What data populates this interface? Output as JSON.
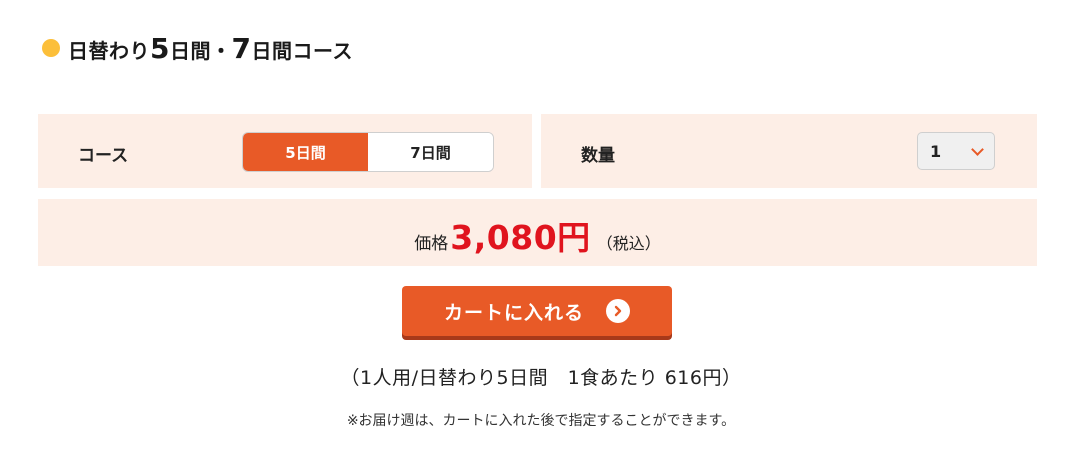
{
  "header": {
    "title_prefix": "日替わり",
    "days_a": "5",
    "days_unit_a": "日間・",
    "days_b": "7",
    "days_unit_b": "日間コース"
  },
  "course": {
    "label": "コース",
    "options": [
      "5日間",
      "7日間"
    ],
    "selected": "5日間"
  },
  "quantity": {
    "label": "数量",
    "value": "1"
  },
  "price": {
    "label": "価格",
    "value": "3,080円",
    "tax_note": "（税込）"
  },
  "cart": {
    "button_label": "カートに入れる"
  },
  "notes": {
    "per_meal": "（1人用/日替わり5日間　1食あたり 616円）",
    "delivery": "※お届け週は、カートに入れた後で指定することができます。"
  },
  "colors": {
    "accent": "#e85a27",
    "panel_bg": "#fdeee6",
    "price": "#e0141e",
    "dot": "#fcbf3a"
  }
}
